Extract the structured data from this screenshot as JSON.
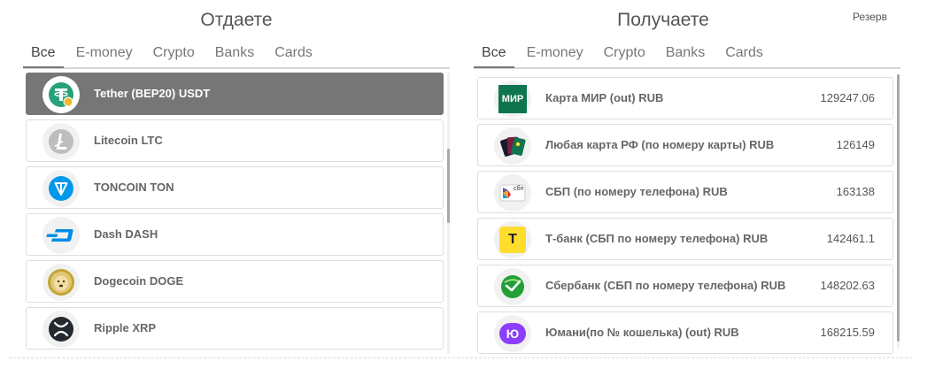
{
  "give": {
    "title": "Отдаете",
    "tabs": [
      "Все",
      "E-money",
      "Crypto",
      "Banks",
      "Cards"
    ],
    "items": [
      {
        "name": "Tether (BEP20) USDT",
        "icon": "tether-icon"
      },
      {
        "name": "Litecoin LTC",
        "icon": "litecoin-icon"
      },
      {
        "name": "TONCOIN TON",
        "icon": "toncoin-icon"
      },
      {
        "name": "Dash DASH",
        "icon": "dash-icon"
      },
      {
        "name": "Dogecoin DOGE",
        "icon": "dogecoin-icon"
      },
      {
        "name": "Ripple XRP",
        "icon": "ripple-icon"
      }
    ]
  },
  "get": {
    "title": "Получаете",
    "reserve_label": "Резерв",
    "tabs": [
      "Все",
      "E-money",
      "Crypto",
      "Banks",
      "Cards"
    ],
    "items": [
      {
        "name": "Карта МИР (out) RUB",
        "amount": "129247.06",
        "icon": "mir-card-icon",
        "icon_text": "МИР"
      },
      {
        "name": "Любая карта РФ (по номеру карты) RUB",
        "amount": "126149",
        "icon": "bank-cards-icon"
      },
      {
        "name": "СБП (по номеру телефона) RUB",
        "amount": "163138",
        "icon": "sbp-icon",
        "icon_text": "сбп"
      },
      {
        "name": "Т-банк (СБП по номеру телефона) RUB",
        "amount": "142461.1",
        "icon": "tbank-icon",
        "icon_text": "T"
      },
      {
        "name": "Сбербанк (СБП по номеру телефона) RUB",
        "amount": "148202.63",
        "icon": "sberbank-icon"
      },
      {
        "name": "Юмани(по № кошелька) (out) RUB",
        "amount": "168215.59",
        "icon": "yoomoney-icon",
        "icon_text": "Ю"
      }
    ]
  },
  "colors": {
    "selected_row": "#767676",
    "tether": "#26a17b",
    "litecoin": "#bdbdbd",
    "toncoin": "#0098ea",
    "dash": "#008de4",
    "dogecoin": "#c2a633",
    "ripple": "#23292f",
    "mir": "#0f754e",
    "tbank": "#ffdd2d",
    "sberbank": "#21a038",
    "yoomoney": "#8b3ffd"
  }
}
